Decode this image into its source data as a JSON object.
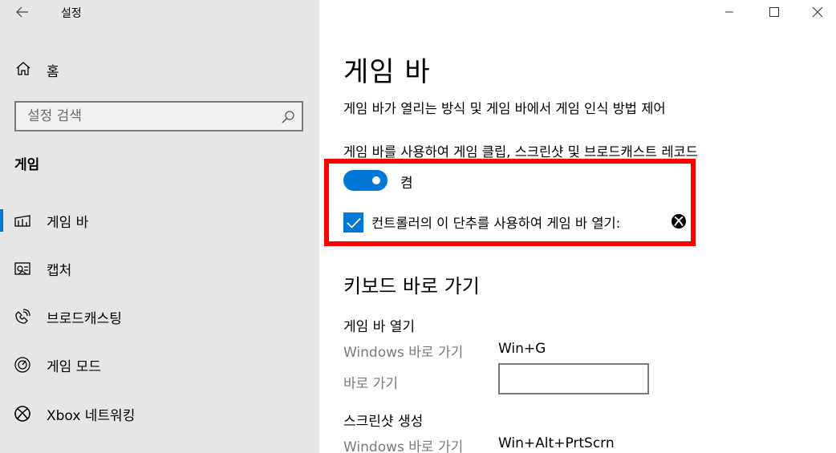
{
  "window": {
    "title": "설정"
  },
  "sidebar": {
    "home_label": "홈",
    "search_placeholder": "설정 검색",
    "section_label": "게임",
    "items": [
      {
        "label": "게임 바",
        "icon": "game-bar-icon",
        "selected": true
      },
      {
        "label": "캡처",
        "icon": "capture-icon",
        "selected": false
      },
      {
        "label": "브로드캐스팅",
        "icon": "broadcasting-icon",
        "selected": false
      },
      {
        "label": "게임 모드",
        "icon": "game-mode-icon",
        "selected": false
      },
      {
        "label": "Xbox 네트워킹",
        "icon": "xbox-icon",
        "selected": false
      }
    ]
  },
  "main": {
    "title": "게임 바",
    "description": "게임 바가 열리는 방식 및 게임 바에서 게임 인식 방법 제어",
    "toggle_caption": "게임 바를 사용하여 게임 클립, 스크린샷 및 브로드캐스트 레코드",
    "toggle_state": "켬",
    "toggle_on": true,
    "checkbox_label": "컨트롤러의 이 단추를 사용하여 게임 바 열기:",
    "checkbox_checked": true,
    "shortcuts_title": "키보드 바로 가기",
    "groups": [
      {
        "heading": "게임 바 열기",
        "windows_label": "Windows 바로 가기",
        "windows_value": "Win+G",
        "custom_label": "바로 가기",
        "custom_value": ""
      },
      {
        "heading": "스크린샷 생성",
        "windows_label": "Windows 바로 가기",
        "windows_value": "Win+Alt+PrtScrn"
      }
    ]
  },
  "colors": {
    "accent": "#0078d7",
    "highlight": "#ff0000",
    "sidebar_bg": "#e6e6e6"
  }
}
